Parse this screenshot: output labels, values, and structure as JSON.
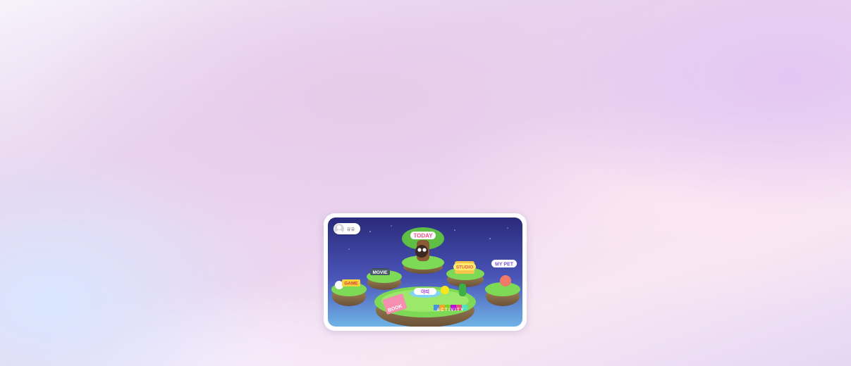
{
  "profile": {
    "name": "유유"
  },
  "islands": {
    "today": "TODAY",
    "movie": "MOVIE",
    "studio": "STUDIO",
    "mypet": "MY PET",
    "game": "GAME",
    "book": "BOOK",
    "activity": "ACTIVITY",
    "center": "아띠"
  },
  "colors": {
    "sky_top": "#2a2a7a",
    "sky_bottom": "#6fb3e6",
    "grass": "#7ed957",
    "water": "#7fd4f5"
  }
}
